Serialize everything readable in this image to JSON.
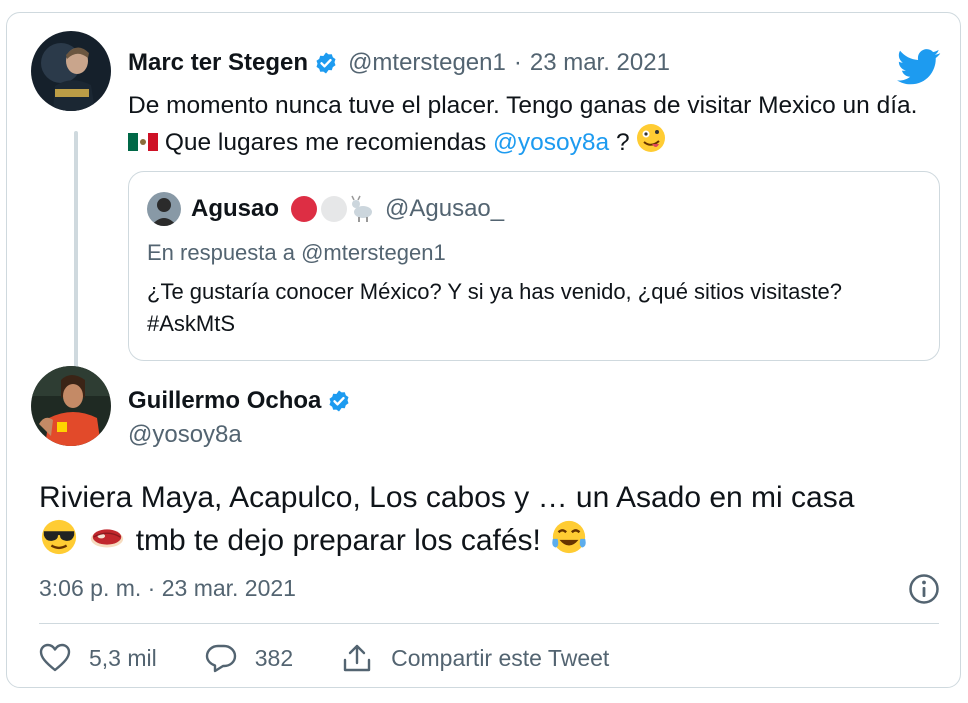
{
  "tweet": {
    "author_name": "Marc ter Stegen",
    "author_handle": "@mterstegen1",
    "separator": "·",
    "date": "23 mar. 2021",
    "text_part1": "De momento nunca tuve el placer. Tengo ganas de visitar Mexico un día.",
    "text_part2": "Que lugares me recomiendas",
    "mention": "@yosoy8a",
    "text_part3": "?",
    "icons": [
      "verified-badge-icon",
      "twitter-bird-icon",
      "mexico-flag-emoji",
      "zany-face-emoji"
    ]
  },
  "quoted": {
    "author_name": "Agusao",
    "author_handle": "@Agusao_",
    "reply_context": "En respuesta a @mterstegen1",
    "text": "¿Te gustaría conocer México? Y si ya has venido, ¿qué sitios visitaste? #AskMtS"
  },
  "reply": {
    "author_name": "Guillermo Ochoa",
    "author_handle": "@yosoy8a",
    "text_part1": "Riviera Maya, Acapulco, Los cabos y … un Asado en mi casa",
    "text_part2": "tmb te dejo preparar los cafés!",
    "time": "3:06 p. m. · 23 mar. 2021",
    "likes": "5,3 mil",
    "replies": "382",
    "share_label": "Compartir este Tweet"
  },
  "colors": {
    "accent": "#1d9bf0",
    "muted": "#536471",
    "border": "#cfd9de",
    "text": "#0f1419"
  }
}
